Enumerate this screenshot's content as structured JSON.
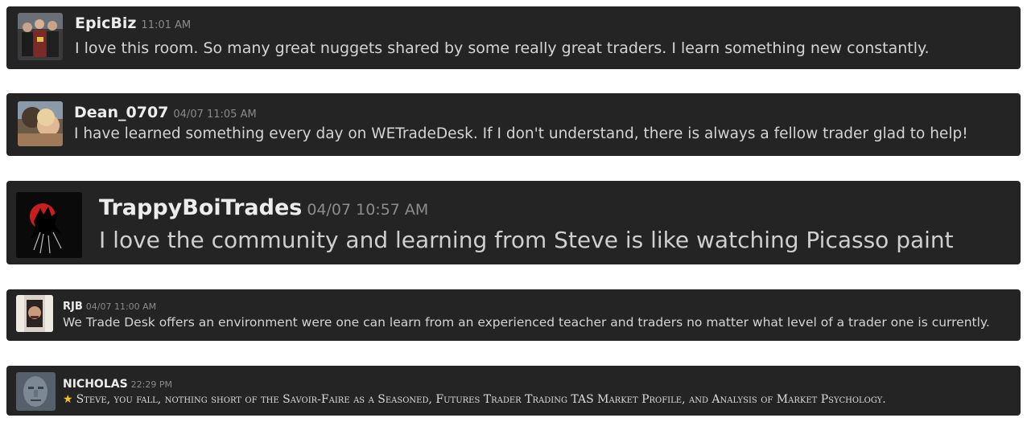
{
  "messages": [
    {
      "username": "EpicBiz",
      "timestamp": "11:01 AM",
      "text": "I love this room. So many great nuggets shared by some really great traders. I learn something new constantly.",
      "avatar_icon": "group-photo-avatar"
    },
    {
      "username": "Dean_0707",
      "timestamp": "04/07 11:05 AM",
      "text": "I have learned something every day on WETradeDesk. If I don't understand, there is always a fellow trader glad to help!",
      "avatar_icon": "child-photo-avatar"
    },
    {
      "username": "TrappyBoiTrades",
      "timestamp": "04/07 10:57 AM",
      "text": "I love the community and learning from Steve is like watching Picasso paint",
      "avatar_icon": "bat-silhouette-avatar"
    },
    {
      "username": "RJB",
      "timestamp": "04/07 11:00 AM",
      "text": "We Trade Desk offers an environment were one can learn from an experienced teacher and traders no matter what level of a trader one is currently.",
      "avatar_icon": "face-in-door-avatar"
    },
    {
      "username": "NICHOLAS",
      "timestamp": "22:29 PM",
      "star": "★",
      "text": "Steve, you fall, nothing short of the Savoir-Faire as a Seasoned, Futures Trader Trading TAS Market Profile, and Analysis of Market Psychology.",
      "avatar_icon": "stone-face-avatar"
    }
  ]
}
